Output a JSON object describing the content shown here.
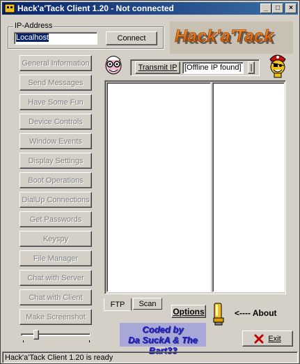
{
  "window": {
    "title": "Hack'a'Tack Client 1.20 - Not connected",
    "minimize": "_",
    "maximize": "□",
    "close": "×"
  },
  "ip": {
    "group_label": "IP-Address",
    "value": "Localhost",
    "connect_label": "Connect"
  },
  "logo_text": "Hack'a'Tack",
  "transmit": {
    "button_label": "Transmit IP",
    "status": "[Offline IP found]",
    "small_button": "|"
  },
  "sidebar": {
    "items": [
      {
        "label": "General Information"
      },
      {
        "label": "Send Messages"
      },
      {
        "label": "Have Some Fun"
      },
      {
        "label": "Device Controls"
      },
      {
        "label": "Window Events"
      },
      {
        "label": "Display Settings"
      },
      {
        "label": "Boot Operations"
      },
      {
        "label": "DialUp Connections"
      },
      {
        "label": "Get Passwords"
      },
      {
        "label": "Keyspy"
      },
      {
        "label": "File Manager"
      },
      {
        "label": "Chat with Server"
      },
      {
        "label": "Chat with Client"
      },
      {
        "label": "Make Screenshot"
      }
    ]
  },
  "tabs": {
    "ftp": "FTP",
    "scan": "Scan"
  },
  "options_label": "Options",
  "about_label": "<---- About",
  "credits": {
    "line1": "Coded by",
    "line2": "Da SuckA & The Bart33"
  },
  "exit_label": "Exit",
  "status": "Hack'a'Tack Client 1.20 is ready",
  "slider": {
    "value": 0.2
  }
}
